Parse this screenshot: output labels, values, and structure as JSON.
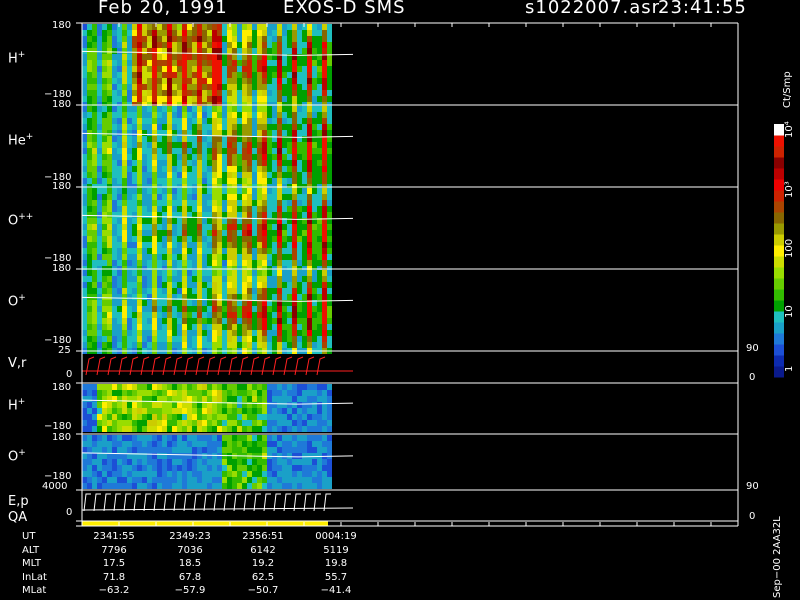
{
  "header": {
    "date": "Feb 20, 1991",
    "mission": "EXOS-D SMS",
    "file": "s1022007.asr",
    "time": "23:41:55"
  },
  "panels": [
    {
      "label": "H",
      "sup": "+",
      "y_top": "180",
      "y_bot": "−180"
    },
    {
      "label": "He",
      "sup": "+",
      "y_top": "180",
      "y_bot": "−180"
    },
    {
      "label": "O",
      "sup": "++",
      "y_top": "180",
      "y_bot": "−180"
    },
    {
      "label": "O",
      "sup": "+",
      "y_top": "180",
      "y_bot": "−180"
    },
    {
      "label": "V,r",
      "sup": "",
      "y_top": "25",
      "y_bot": "0",
      "r_top": "90",
      "r_bot": "0"
    },
    {
      "label": "H",
      "sup": "+",
      "y_top": "180",
      "y_bot": "−180"
    },
    {
      "label": "O",
      "sup": "+",
      "y_top": "180",
      "y_bot": "−180"
    },
    {
      "label": "E,p",
      "sup": "",
      "y_top": "4000",
      "y_bot": "0",
      "r_top": "90",
      "r_bot": "0"
    }
  ],
  "qa_label": "QA",
  "colorbar": {
    "title": "Ct/Smp",
    "ticks": [
      "1",
      "10",
      "100",
      "10³",
      "10⁴"
    ],
    "colors": [
      "#0a1a8c",
      "#0d2bb0",
      "#1c4fd6",
      "#1f79d8",
      "#1aa0c8",
      "#1fbfbf",
      "#00a000",
      "#33bb00",
      "#66cc00",
      "#99dd00",
      "#ccdd00",
      "#ffee00",
      "#cccc00",
      "#999900",
      "#886600",
      "#aa4400",
      "#cc2200",
      "#ee0000",
      "#bb0000",
      "#880000",
      "#cc2200",
      "#ee1100",
      "#ffffff"
    ]
  },
  "footer": {
    "rows": [
      {
        "name": "UT",
        "values": [
          "2341:55",
          "2349:23",
          "2356:51",
          "0004:19"
        ]
      },
      {
        "name": "ALT",
        "values": [
          "7796",
          "7036",
          "6142",
          "5119"
        ]
      },
      {
        "name": "MLT",
        "values": [
          "17.5",
          "18.5",
          "19.2",
          "19.8"
        ]
      },
      {
        "name": "InLat",
        "values": [
          "71.8",
          "67.8",
          "62.5",
          "55.7"
        ]
      },
      {
        "name": "MLat",
        "values": [
          "−63.2",
          "−57.9",
          "−50.7",
          "−41.4"
        ]
      }
    ]
  },
  "stamp": "Sep−00  2AA32L",
  "chart_data": {
    "type": "heatmap",
    "title": "Feb 20, 1991   EXOS-D SMS",
    "x_ticks_ut": [
      "2341:55",
      "2349:23",
      "2356:51",
      "0004:19"
    ],
    "colorscale_units": "Ct/Smp",
    "colorscale_ticks": [
      "1",
      "10",
      "100",
      "10³",
      "10⁴"
    ],
    "panels": [
      {
        "name": "H+",
        "y_range": [
          -180,
          180
        ]
      },
      {
        "name": "He+",
        "y_range": [
          -180,
          180
        ]
      },
      {
        "name": "O++",
        "y_range": [
          -180,
          180
        ]
      },
      {
        "name": "O+",
        "y_range": [
          -180,
          180
        ]
      },
      {
        "name": "V,r",
        "y_range": [
          0,
          25
        ],
        "y2_range": [
          0,
          90
        ]
      },
      {
        "name": "H+",
        "y_range": [
          -180,
          180
        ]
      },
      {
        "name": "O+",
        "y_range": [
          -180,
          180
        ]
      },
      {
        "name": "E,p",
        "y_range": [
          0,
          4000
        ],
        "y2_range": [
          0,
          90
        ]
      }
    ]
  }
}
